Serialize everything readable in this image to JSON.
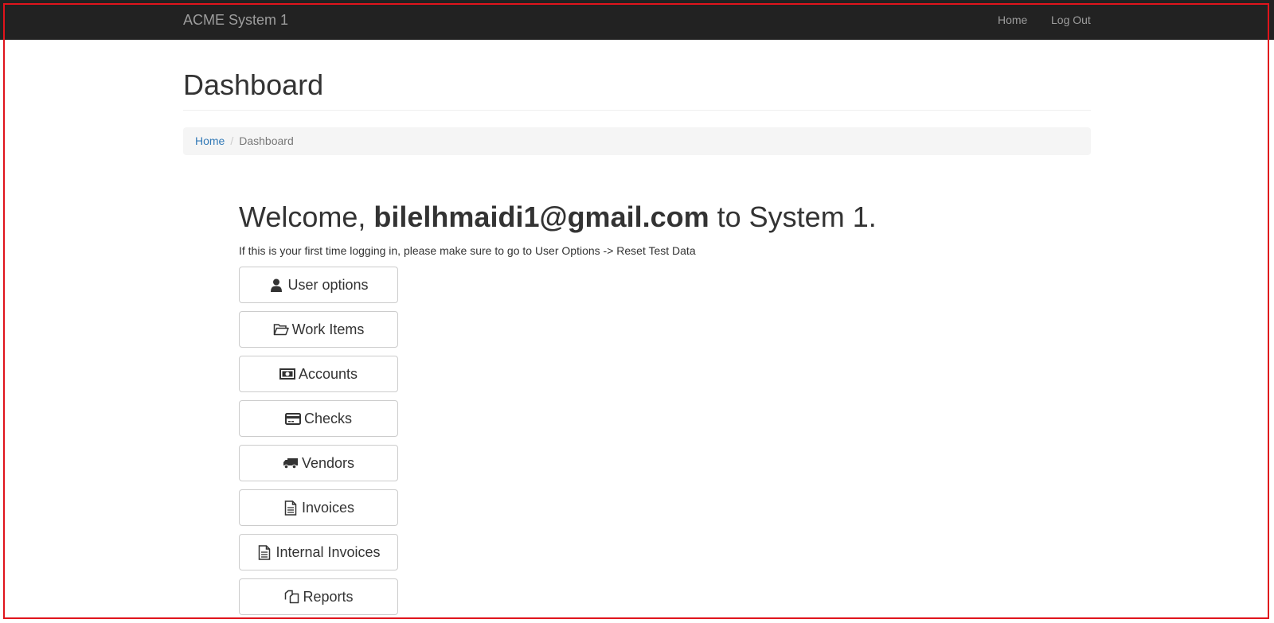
{
  "navbar": {
    "brand": "ACME System 1",
    "links": [
      {
        "label": "Home"
      },
      {
        "label": "Log Out"
      }
    ]
  },
  "page": {
    "title": "Dashboard"
  },
  "breadcrumb": {
    "items": [
      {
        "label": "Home"
      },
      {
        "label": "Dashboard"
      }
    ]
  },
  "welcome": {
    "prefix": "Welcome,",
    "user": "bilelhmaidi1@gmail.com",
    "suffix": "to System 1.",
    "hint": "If this is your first time logging in, please make sure to go to User Options -> Reset Test Data"
  },
  "menu": [
    {
      "label": "User options",
      "icon": "user-icon"
    },
    {
      "label": "Work Items",
      "icon": "folder-open-icon"
    },
    {
      "label": "Accounts",
      "icon": "money-icon"
    },
    {
      "label": "Checks",
      "icon": "credit-card-icon"
    },
    {
      "label": "Vendors",
      "icon": "truck-icon"
    },
    {
      "label": "Invoices",
      "icon": "file-text-icon"
    },
    {
      "label": "Internal Invoices",
      "icon": "file-text-icon"
    },
    {
      "label": "Reports",
      "icon": "copy-icon"
    }
  ],
  "colors": {
    "navbar_bg": "#222222",
    "navbar_text": "#9d9d9d",
    "link": "#337ab7",
    "frame": "#e0141c"
  }
}
